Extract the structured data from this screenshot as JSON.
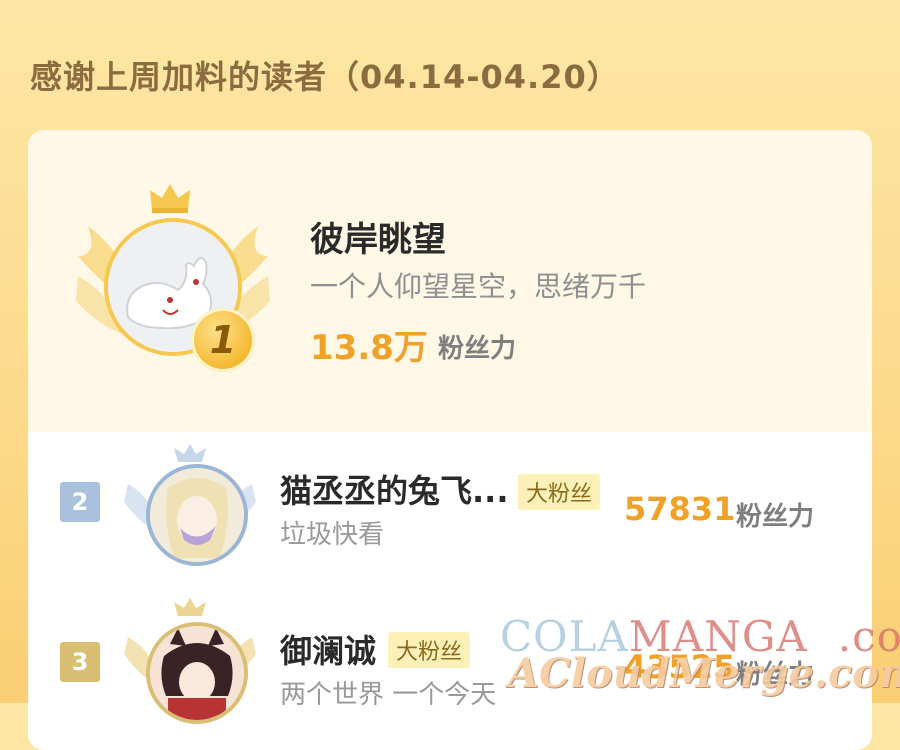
{
  "page": {
    "title": "感谢上周加料的读者（04.14-04.20）"
  },
  "top_reader": {
    "rank": "1",
    "name": "彼岸眺望",
    "bio": "一个人仰望星空，思绪万千",
    "score": "13.8万",
    "score_label": "粉丝力"
  },
  "readers": [
    {
      "rank": "2",
      "name": "猫丞丞的兔飞...",
      "badge": "大粉丝",
      "sub": "垃圾快看",
      "score": "57831",
      "score_label": "粉丝力"
    },
    {
      "rank": "3",
      "name": "御澜诚",
      "badge": "大粉丝",
      "sub": "两个世界 一个今天",
      "score": "43525",
      "score_label": "粉丝力"
    }
  ],
  "watermark": {
    "line1_a": "COLA",
    "line1_b": "MANGA",
    "line1_c": ".com",
    "line2": "ACloudMerge.com"
  },
  "colors": {
    "accent": "#f0a128",
    "gold": "#f6c84f",
    "silver": "#a9c1dc",
    "bronze": "#d8bf74"
  },
  "icons": {
    "crown": "crown-icon",
    "wings": "wings-icon"
  }
}
